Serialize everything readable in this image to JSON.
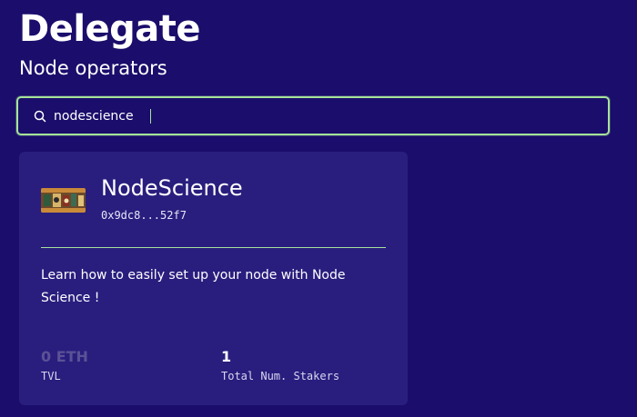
{
  "header": {
    "title": "Delegate",
    "subtitle": "Node operators"
  },
  "search": {
    "value": "nodescience",
    "icon": "search-icon"
  },
  "operator_card": {
    "name": "NodeScience",
    "address": "0x9dc8...52f7",
    "description": "Learn how to easily set up your node with Node Science !",
    "stats": {
      "tvl_value": "0 ETH",
      "tvl_label": "TVL",
      "stakers_value": "1",
      "stakers_label": "Total Num. Stakers"
    }
  },
  "colors": {
    "background": "#1a0d6b",
    "card": "#291e7e",
    "accent": "#a6e39a",
    "muted_value": "#5b5296"
  }
}
